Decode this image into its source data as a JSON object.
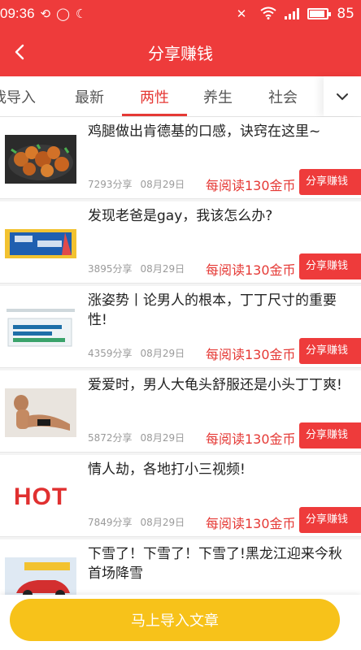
{
  "status_bar": {
    "time": "09:36",
    "battery": "85"
  },
  "header": {
    "title": "分享赚钱"
  },
  "tabs": [
    {
      "label": "我导入"
    },
    {
      "label": "最新"
    },
    {
      "label": "两性"
    },
    {
      "label": "养生"
    },
    {
      "label": "社会"
    }
  ],
  "articles": [
    {
      "title": "鸡腿做出肯德基的口感，诀窍在这里~",
      "shares": "7293分享",
      "date": "08月29日",
      "reward": "每阅读130金币",
      "button": "分享赚钱",
      "thumb": "fried-chicken"
    },
    {
      "title": "发现老爸是gay，我该怎么办?",
      "shares": "3895分享",
      "date": "08月29日",
      "reward": "每阅读130金币",
      "button": "分享赚钱",
      "thumb": "banner"
    },
    {
      "title": "涨姿势丨论男人的根本，丁丁尺寸的重要性!",
      "shares": "4359分享",
      "date": "08月29日",
      "reward": "每阅读130金币",
      "button": "分享赚钱",
      "thumb": "chart"
    },
    {
      "title": "爱爱时，男人大龟头舒服还是小头丁丁爽!",
      "shares": "5872分享",
      "date": "08月29日",
      "reward": "每阅读130金币",
      "button": "分享赚钱",
      "thumb": "model"
    },
    {
      "title": "情人劫，各地打小三视频!",
      "shares": "7849分享",
      "date": "08月29日",
      "reward": "每阅读130金币",
      "button": "分享赚钱",
      "thumb": "hot"
    },
    {
      "title": "下雪了！下雪了！下雪了!黑龙江迎来今秋首场降雪",
      "shares": "",
      "date": "",
      "reward": "",
      "button": "",
      "thumb": "car-ad"
    }
  ],
  "thumb_hot_text": "HOT",
  "bottom": {
    "import_button": "马上导入文章"
  },
  "colors": {
    "primary_red": "#ee3b3b",
    "yellow_button": "#f7c21a"
  }
}
